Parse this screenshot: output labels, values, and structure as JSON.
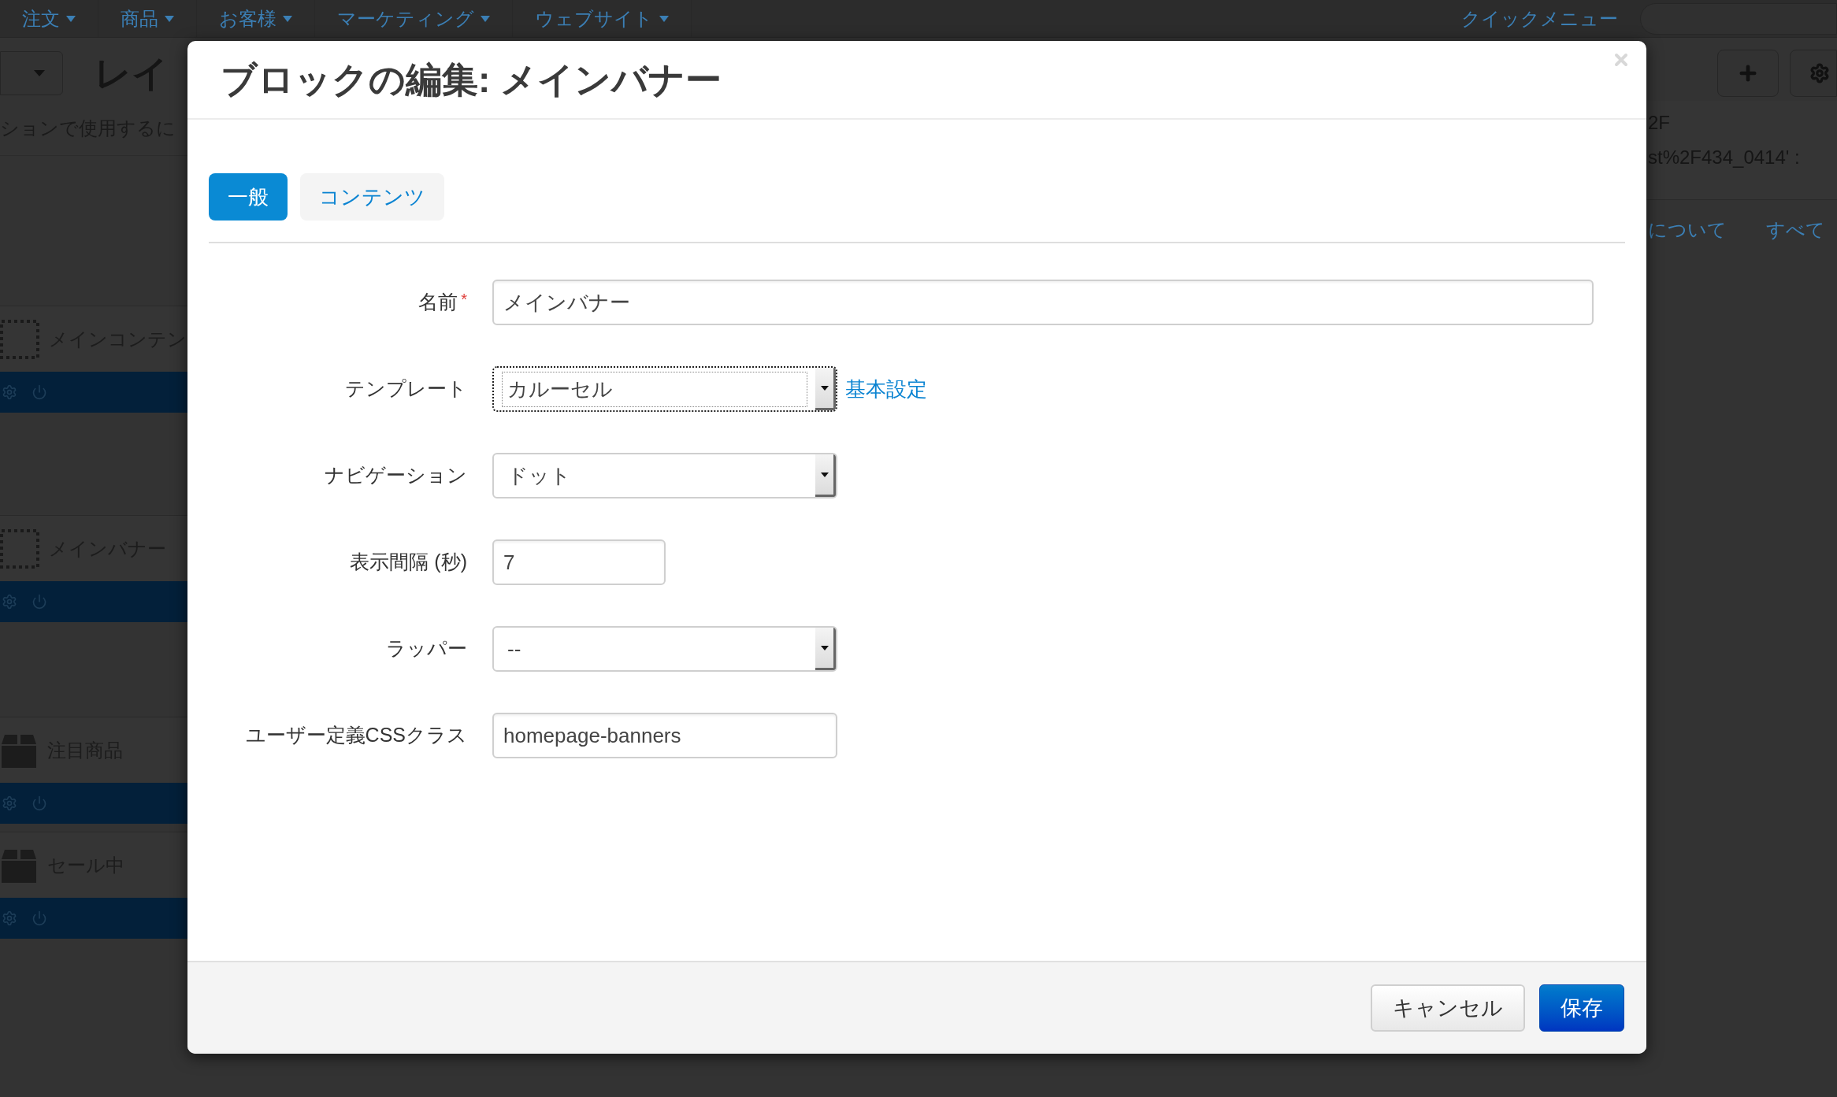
{
  "nav": {
    "items": [
      "注文",
      "商品",
      "お客様",
      "マーケティング",
      "ウェブサイト"
    ],
    "quick_menu": "クイックメニュー"
  },
  "page": {
    "title": "レイ",
    "description": "ションで使用するに",
    "url_lines": [
      "2F",
      "st%2F434_0414' :"
    ],
    "links": [
      "について",
      "すべて"
    ]
  },
  "blocks": [
    {
      "name": "メインコンテン",
      "kind": "container"
    },
    {
      "name": "メインバナー",
      "kind": "container"
    },
    {
      "name": "注目商品",
      "kind": "product"
    },
    {
      "name": "セール中",
      "kind": "product"
    }
  ],
  "dialog": {
    "title": "ブロックの編集: メインバナー",
    "tabs": [
      {
        "label": "一般",
        "selected": true
      },
      {
        "label": "コンテンツ",
        "selected": false
      }
    ],
    "fields": [
      {
        "label": "名前",
        "required_mark": "*",
        "kind": "wide_text",
        "value": "メインバナー"
      },
      {
        "label": "テンプレート",
        "kind": "select",
        "value": "カルーセル",
        "focused": true,
        "link": "基本設定"
      },
      {
        "label": "ナビゲーション",
        "kind": "select",
        "value": "ドット",
        "focused": false
      },
      {
        "label": "表示間隔 (秒)",
        "kind": "short_text",
        "value": "7"
      },
      {
        "label": "ラッパー",
        "kind": "select",
        "value": "--",
        "focused": false
      },
      {
        "label": "ユーザー定義CSSクラス",
        "kind": "text",
        "value": "homepage-banners"
      }
    ],
    "buttons": [
      {
        "label": "キャンセル",
        "kind": "secondary"
      },
      {
        "label": "保存",
        "kind": "primary"
      }
    ]
  }
}
